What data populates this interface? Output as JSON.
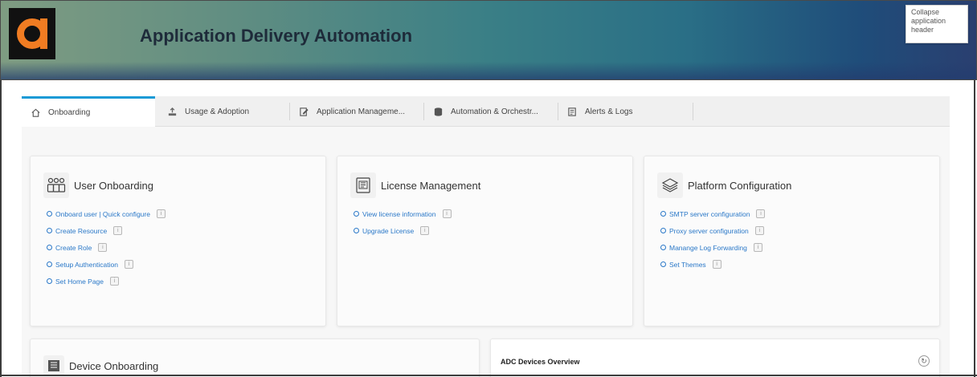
{
  "header": {
    "title": "Application Delivery Automation",
    "collapse_tooltip": "Collapse application header",
    "logo_icon": "product-logo-icon",
    "colors": {
      "accent": "#1a9ad6",
      "logo": "#f07c22",
      "link": "#2a78c8"
    }
  },
  "tabs": [
    {
      "label": "Onboarding",
      "icon": "home-icon",
      "active": true
    },
    {
      "label": "Usage & Adoption",
      "icon": "upload-icon",
      "active": false
    },
    {
      "label": "Application Manageme...",
      "icon": "edit-document-icon",
      "active": false
    },
    {
      "label": "Automation & Orchestr...",
      "icon": "database-icon",
      "active": false
    },
    {
      "label": "Alerts & Logs",
      "icon": "log-icon",
      "active": false
    }
  ],
  "cards": {
    "user_onboarding": {
      "title": "User Onboarding",
      "icon": "users-icon",
      "links": [
        "Onboard user | Quick configure",
        "Create Resource",
        "Create Role",
        "Setup Authentication",
        "Set Home Page"
      ]
    },
    "license_management": {
      "title": "License Management",
      "icon": "license-icon",
      "links": [
        "View license information",
        "Upgrade License"
      ]
    },
    "platform_configuration": {
      "title": "Platform Configuration",
      "icon": "layers-icon",
      "links": [
        "SMTP server configuration",
        "Proxy server configuration",
        "Manange Log Forwarding",
        "Set Themes"
      ]
    },
    "device_onboarding": {
      "title": "Device Onboarding",
      "icon": "device-icon"
    },
    "adc_overview": {
      "title": "ADC Devices Overview",
      "icon": "refresh-icon"
    }
  },
  "info_glyph": "i"
}
